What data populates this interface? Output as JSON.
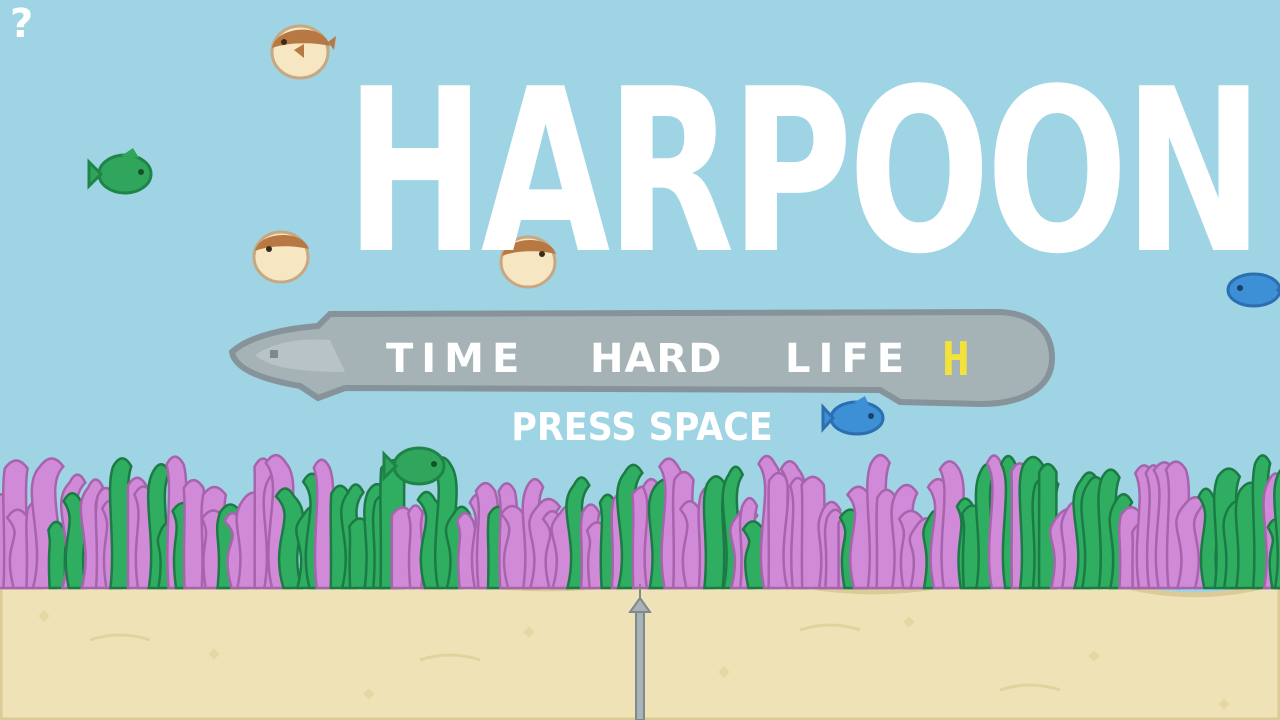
{
  "game": {
    "title": "HARPOON !",
    "help_label": "?",
    "menu": {
      "time_label": "TIME",
      "difficulty_label": "HARD",
      "life_label": "LIFE",
      "selected_indicator": "H"
    },
    "prompt": "PRESS SPACE"
  },
  "colors": {
    "water": "#9fd4e4",
    "sand": "#efe2b6",
    "sand_edge": "#dccb96",
    "eel_body": "#a5b3b7",
    "eel_outline": "#86939a",
    "kelp_green": "#2fae62",
    "kelp_pink": "#d18ad8",
    "puffer_brown": "#b87844",
    "puffer_belly": "#f6e6c2",
    "fish_green": "#2fa65c",
    "fish_blue": "#3d8fd6",
    "selected": "#f2e23a",
    "text": "#ffffff"
  }
}
